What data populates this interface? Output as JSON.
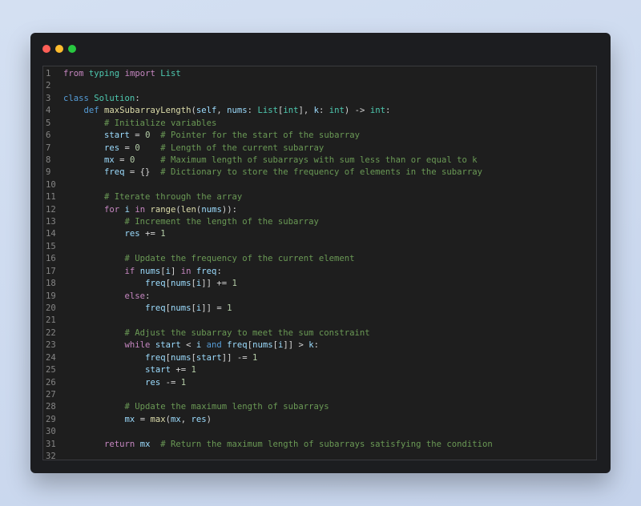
{
  "window": {
    "controls": [
      "close",
      "minimize",
      "maximize"
    ]
  },
  "editor": {
    "language": "python",
    "lines": [
      {
        "n": "1",
        "tokens": [
          {
            "t": "from",
            "c": "kw"
          },
          {
            "t": " ",
            "c": "op"
          },
          {
            "t": "typing",
            "c": "cls"
          },
          {
            "t": " ",
            "c": "op"
          },
          {
            "t": "import",
            "c": "kw"
          },
          {
            "t": " ",
            "c": "op"
          },
          {
            "t": "List",
            "c": "cls"
          }
        ]
      },
      {
        "n": "2",
        "tokens": []
      },
      {
        "n": "3",
        "tokens": [
          {
            "t": "class",
            "c": "kw2"
          },
          {
            "t": " ",
            "c": "op"
          },
          {
            "t": "Solution",
            "c": "cls"
          },
          {
            "t": ":",
            "c": "op"
          }
        ]
      },
      {
        "n": "4",
        "tokens": [
          {
            "t": "    ",
            "c": "op"
          },
          {
            "t": "def",
            "c": "kw2"
          },
          {
            "t": " ",
            "c": "op"
          },
          {
            "t": "maxSubarrayLength",
            "c": "fn"
          },
          {
            "t": "(",
            "c": "op"
          },
          {
            "t": "self",
            "c": "var"
          },
          {
            "t": ", ",
            "c": "op"
          },
          {
            "t": "nums",
            "c": "var"
          },
          {
            "t": ": ",
            "c": "op"
          },
          {
            "t": "List",
            "c": "cls"
          },
          {
            "t": "[",
            "c": "op"
          },
          {
            "t": "int",
            "c": "cls"
          },
          {
            "t": "], ",
            "c": "op"
          },
          {
            "t": "k",
            "c": "var"
          },
          {
            "t": ": ",
            "c": "op"
          },
          {
            "t": "int",
            "c": "cls"
          },
          {
            "t": ") -> ",
            "c": "op"
          },
          {
            "t": "int",
            "c": "cls"
          },
          {
            "t": ":",
            "c": "op"
          }
        ]
      },
      {
        "n": "5",
        "tokens": [
          {
            "t": "        ",
            "c": "op"
          },
          {
            "t": "# Initialize variables",
            "c": "cm"
          }
        ]
      },
      {
        "n": "6",
        "tokens": [
          {
            "t": "        ",
            "c": "op"
          },
          {
            "t": "start",
            "c": "var"
          },
          {
            "t": " = ",
            "c": "op"
          },
          {
            "t": "0",
            "c": "num"
          },
          {
            "t": "  ",
            "c": "op"
          },
          {
            "t": "# Pointer for the start of the subarray",
            "c": "cm"
          }
        ]
      },
      {
        "n": "7",
        "tokens": [
          {
            "t": "        ",
            "c": "op"
          },
          {
            "t": "res",
            "c": "var"
          },
          {
            "t": " = ",
            "c": "op"
          },
          {
            "t": "0",
            "c": "num"
          },
          {
            "t": "    ",
            "c": "op"
          },
          {
            "t": "# Length of the current subarray",
            "c": "cm"
          }
        ]
      },
      {
        "n": "8",
        "tokens": [
          {
            "t": "        ",
            "c": "op"
          },
          {
            "t": "mx",
            "c": "var"
          },
          {
            "t": " = ",
            "c": "op"
          },
          {
            "t": "0",
            "c": "num"
          },
          {
            "t": "     ",
            "c": "op"
          },
          {
            "t": "# Maximum length of subarrays with sum less than or equal to k",
            "c": "cm"
          }
        ]
      },
      {
        "n": "9",
        "tokens": [
          {
            "t": "        ",
            "c": "op"
          },
          {
            "t": "freq",
            "c": "var"
          },
          {
            "t": " = {}  ",
            "c": "op"
          },
          {
            "t": "# Dictionary to store the frequency of elements in the subarray",
            "c": "cm"
          }
        ]
      },
      {
        "n": "10",
        "tokens": []
      },
      {
        "n": "11",
        "tokens": [
          {
            "t": "        ",
            "c": "op"
          },
          {
            "t": "# Iterate through the array",
            "c": "cm"
          }
        ]
      },
      {
        "n": "12",
        "tokens": [
          {
            "t": "        ",
            "c": "op"
          },
          {
            "t": "for",
            "c": "kw"
          },
          {
            "t": " ",
            "c": "op"
          },
          {
            "t": "i",
            "c": "var"
          },
          {
            "t": " ",
            "c": "op"
          },
          {
            "t": "in",
            "c": "kw"
          },
          {
            "t": " ",
            "c": "op"
          },
          {
            "t": "range",
            "c": "fn"
          },
          {
            "t": "(",
            "c": "op"
          },
          {
            "t": "len",
            "c": "fn"
          },
          {
            "t": "(",
            "c": "op"
          },
          {
            "t": "nums",
            "c": "var"
          },
          {
            "t": ")):",
            "c": "op"
          }
        ]
      },
      {
        "n": "13",
        "tokens": [
          {
            "t": "            ",
            "c": "op"
          },
          {
            "t": "# Increment the length of the subarray",
            "c": "cm"
          }
        ]
      },
      {
        "n": "14",
        "tokens": [
          {
            "t": "            ",
            "c": "op"
          },
          {
            "t": "res",
            "c": "var"
          },
          {
            "t": " += ",
            "c": "op"
          },
          {
            "t": "1",
            "c": "num"
          }
        ]
      },
      {
        "n": "15",
        "tokens": []
      },
      {
        "n": "16",
        "tokens": [
          {
            "t": "            ",
            "c": "op"
          },
          {
            "t": "# Update the frequency of the current element",
            "c": "cm"
          }
        ]
      },
      {
        "n": "17",
        "tokens": [
          {
            "t": "            ",
            "c": "op"
          },
          {
            "t": "if",
            "c": "kw"
          },
          {
            "t": " ",
            "c": "op"
          },
          {
            "t": "nums",
            "c": "var"
          },
          {
            "t": "[",
            "c": "op"
          },
          {
            "t": "i",
            "c": "var"
          },
          {
            "t": "] ",
            "c": "op"
          },
          {
            "t": "in",
            "c": "kw"
          },
          {
            "t": " ",
            "c": "op"
          },
          {
            "t": "freq",
            "c": "var"
          },
          {
            "t": ":",
            "c": "op"
          }
        ]
      },
      {
        "n": "18",
        "tokens": [
          {
            "t": "                ",
            "c": "op"
          },
          {
            "t": "freq",
            "c": "var"
          },
          {
            "t": "[",
            "c": "op"
          },
          {
            "t": "nums",
            "c": "var"
          },
          {
            "t": "[",
            "c": "op"
          },
          {
            "t": "i",
            "c": "var"
          },
          {
            "t": "]] += ",
            "c": "op"
          },
          {
            "t": "1",
            "c": "num"
          }
        ]
      },
      {
        "n": "19",
        "tokens": [
          {
            "t": "            ",
            "c": "op"
          },
          {
            "t": "else",
            "c": "kw"
          },
          {
            "t": ":",
            "c": "op"
          }
        ]
      },
      {
        "n": "20",
        "tokens": [
          {
            "t": "                ",
            "c": "op"
          },
          {
            "t": "freq",
            "c": "var"
          },
          {
            "t": "[",
            "c": "op"
          },
          {
            "t": "nums",
            "c": "var"
          },
          {
            "t": "[",
            "c": "op"
          },
          {
            "t": "i",
            "c": "var"
          },
          {
            "t": "]] = ",
            "c": "op"
          },
          {
            "t": "1",
            "c": "num"
          }
        ]
      },
      {
        "n": "21",
        "tokens": []
      },
      {
        "n": "22",
        "tokens": [
          {
            "t": "            ",
            "c": "op"
          },
          {
            "t": "# Adjust the subarray to meet the sum constraint",
            "c": "cm"
          }
        ]
      },
      {
        "n": "23",
        "tokens": [
          {
            "t": "            ",
            "c": "op"
          },
          {
            "t": "while",
            "c": "kw"
          },
          {
            "t": " ",
            "c": "op"
          },
          {
            "t": "start",
            "c": "var"
          },
          {
            "t": " < ",
            "c": "op"
          },
          {
            "t": "i",
            "c": "var"
          },
          {
            "t": " ",
            "c": "op"
          },
          {
            "t": "and",
            "c": "kw2"
          },
          {
            "t": " ",
            "c": "op"
          },
          {
            "t": "freq",
            "c": "var"
          },
          {
            "t": "[",
            "c": "op"
          },
          {
            "t": "nums",
            "c": "var"
          },
          {
            "t": "[",
            "c": "op"
          },
          {
            "t": "i",
            "c": "var"
          },
          {
            "t": "]] > ",
            "c": "op"
          },
          {
            "t": "k",
            "c": "var"
          },
          {
            "t": ":",
            "c": "op"
          }
        ]
      },
      {
        "n": "24",
        "tokens": [
          {
            "t": "                ",
            "c": "op"
          },
          {
            "t": "freq",
            "c": "var"
          },
          {
            "t": "[",
            "c": "op"
          },
          {
            "t": "nums",
            "c": "var"
          },
          {
            "t": "[",
            "c": "op"
          },
          {
            "t": "start",
            "c": "var"
          },
          {
            "t": "]] -= ",
            "c": "op"
          },
          {
            "t": "1",
            "c": "num"
          }
        ]
      },
      {
        "n": "25",
        "tokens": [
          {
            "t": "                ",
            "c": "op"
          },
          {
            "t": "start",
            "c": "var"
          },
          {
            "t": " += ",
            "c": "op"
          },
          {
            "t": "1",
            "c": "num"
          }
        ]
      },
      {
        "n": "26",
        "tokens": [
          {
            "t": "                ",
            "c": "op"
          },
          {
            "t": "res",
            "c": "var"
          },
          {
            "t": " -= ",
            "c": "op"
          },
          {
            "t": "1",
            "c": "num"
          }
        ]
      },
      {
        "n": "27",
        "tokens": []
      },
      {
        "n": "28",
        "tokens": [
          {
            "t": "            ",
            "c": "op"
          },
          {
            "t": "# Update the maximum length of subarrays",
            "c": "cm"
          }
        ]
      },
      {
        "n": "29",
        "tokens": [
          {
            "t": "            ",
            "c": "op"
          },
          {
            "t": "mx",
            "c": "var"
          },
          {
            "t": " = ",
            "c": "op"
          },
          {
            "t": "max",
            "c": "fn"
          },
          {
            "t": "(",
            "c": "op"
          },
          {
            "t": "mx",
            "c": "var"
          },
          {
            "t": ", ",
            "c": "op"
          },
          {
            "t": "res",
            "c": "var"
          },
          {
            "t": ")",
            "c": "op"
          }
        ]
      },
      {
        "n": "30",
        "tokens": []
      },
      {
        "n": "31",
        "tokens": [
          {
            "t": "        ",
            "c": "op"
          },
          {
            "t": "return",
            "c": "kw"
          },
          {
            "t": " ",
            "c": "op"
          },
          {
            "t": "mx",
            "c": "var"
          },
          {
            "t": "  ",
            "c": "op"
          },
          {
            "t": "# Return the maximum length of subarrays satisfying the condition",
            "c": "cm"
          }
        ]
      },
      {
        "n": "32",
        "tokens": []
      }
    ]
  }
}
